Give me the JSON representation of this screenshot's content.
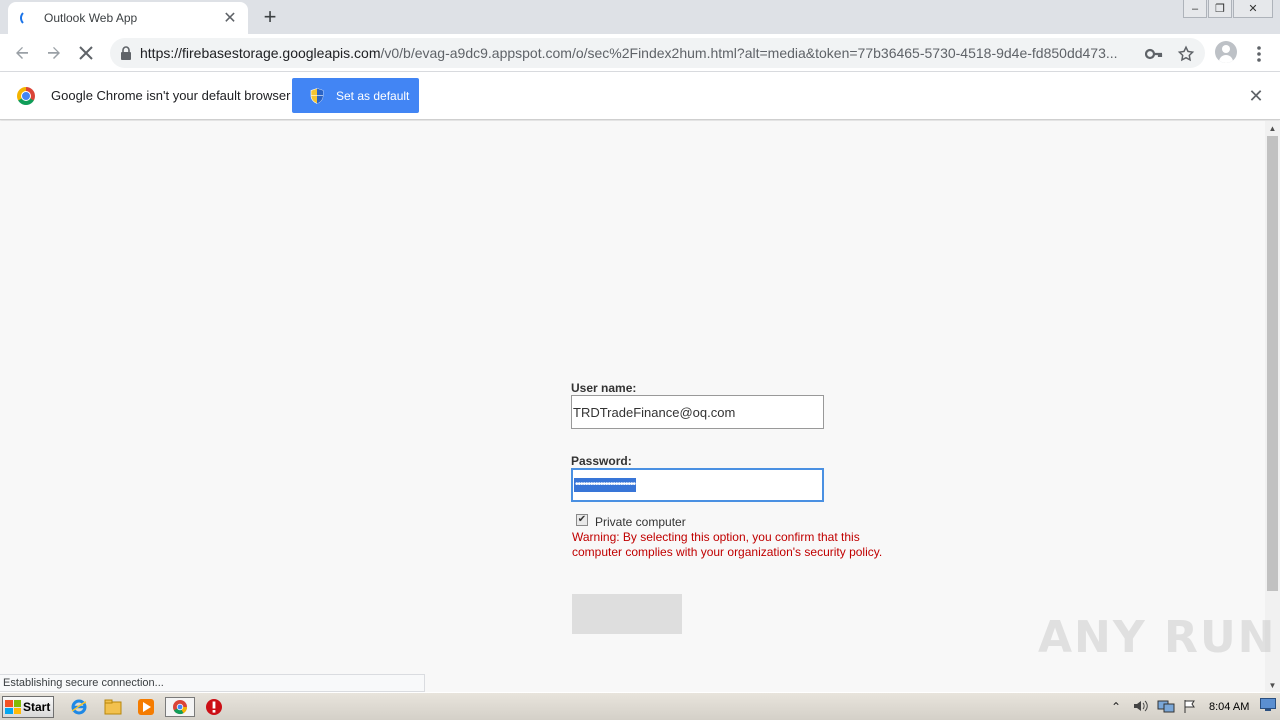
{
  "browser": {
    "tab_title": "Outlook Web App",
    "tab_close": "✕",
    "new_tab": "+",
    "url_host": "https://firebasestorage.googleapis.com",
    "url_path": "/v0/b/evag-a9dc9.appspot.com/o/sec%2Findex2hum.html?alt=media&token=77b36465-5730-4518-9d4e-fd850dd473...",
    "window_controls": [
      "–",
      "❐",
      "✕"
    ]
  },
  "infobar": {
    "message": "Google Chrome isn't your default browser",
    "button_label": "Set as default",
    "close": "✕"
  },
  "form": {
    "username_label": "User name:",
    "username_value": "TRDTradeFinance@oq.com",
    "password_label": "Password:",
    "password_masked": "••••••••••••••••••••••••",
    "checkbox_checked": true,
    "checkbox_label": "Private computer",
    "warning": "Warning: By selecting this option, you confirm that this computer complies with your organization's security policy."
  },
  "status_bar": {
    "text": "Establishing secure connection..."
  },
  "watermark": "ANY RUN",
  "taskbar": {
    "start_label": "Start",
    "clock": "8:04 AM"
  },
  "colors": {
    "accent": "#4285f4",
    "warning_text": "#c00000",
    "selection": "#3875d7"
  }
}
